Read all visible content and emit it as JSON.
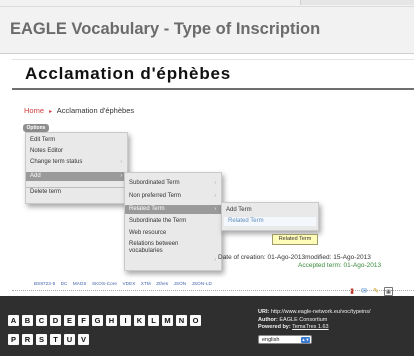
{
  "site": {
    "title": "EAGLE Vocabulary - Type of Inscription"
  },
  "page": {
    "title": "Acclamation d'éphèbes"
  },
  "breadcrumb": {
    "home": "Home",
    "separator": "▸",
    "current": "Acclamation d'éphèbes"
  },
  "options": {
    "label": "Options"
  },
  "menu_main": [
    {
      "label": "Edit Term",
      "arrow": ""
    },
    {
      "label": "Notes Editor",
      "arrow": ""
    },
    {
      "label": "Change term status",
      "arrow": "›"
    },
    {
      "label": "Add",
      "arrow": "›"
    },
    {
      "label": "Delete term",
      "arrow": ""
    }
  ],
  "menu_add": [
    {
      "label": "Subordinated Term",
      "arrow": "›"
    },
    {
      "label": "Non preferred Term",
      "arrow": "›"
    },
    {
      "label": "Related Term",
      "arrow": "›"
    },
    {
      "label": "Subordinate the Term",
      "arrow": ""
    },
    {
      "label": "Web resource",
      "arrow": ""
    },
    {
      "label": "Relations between vocabularies",
      "arrow": "›"
    }
  ],
  "menu_related": [
    {
      "label": "Add Term"
    },
    {
      "label": "Related Term"
    }
  ],
  "tooltip": "Related Term",
  "dates": {
    "creation_modified": "Date of creation: 01-Ago-2013modified: 15-Ago-2013",
    "accepted": "Accepted term: 01-Ago-2013"
  },
  "formats": [
    "BS8723-5",
    "DC",
    "MADS",
    "SKOS-Core",
    "VDEX",
    "XTM",
    "Zthes",
    "JSON",
    "JSON-LD"
  ],
  "share_icons": [
    "chart-icon",
    "mail-icon",
    "pen-icon",
    "qr-icon"
  ],
  "alphabet_row1": [
    "A",
    "B",
    "C",
    "D",
    "E",
    "F",
    "G",
    "H",
    "I",
    "K",
    "L",
    "M",
    "N",
    "O"
  ],
  "alphabet_row2": [
    "P",
    "R",
    "S",
    "T",
    "U",
    "V"
  ],
  "footer": {
    "uri_label": "URI:",
    "uri_value": "http://www.eagle-network.eu/voc/typeins/",
    "author_label": "Author:",
    "author_value": "EAGLE Consortium",
    "powered_label": "Powered by:",
    "powered_value": "TemaTres 1.63",
    "language": "english"
  },
  "colors": {
    "home_link": "#d23c3c",
    "footer_bg": "#2f2f2f",
    "menu_active": "#9a9a9a",
    "accepted_text": "#3a8a3a",
    "link": "#3b5ea8"
  }
}
